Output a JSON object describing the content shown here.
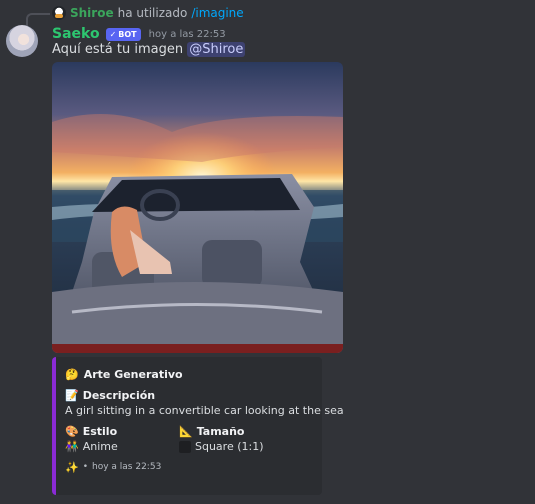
{
  "reply": {
    "username": "Shiroe",
    "action_text": "ha utilizado",
    "command": "/imagine"
  },
  "message": {
    "author": "Saeko",
    "bot_badge": "BOT",
    "timestamp": "hoy a las 22:53",
    "text": "Aquí está tu imagen",
    "mention": "@Shiroe"
  },
  "embed": {
    "accent_color": "#8b2bd6",
    "title_icon": "🤔",
    "title": "Arte Generativo",
    "description_icon": "📝",
    "description_label": "Descripción",
    "description": "A girl sitting in a convertible car looking at the sea",
    "style_icon": "🎨",
    "style_label": "Estilo",
    "style_value_icon": "👫",
    "style_value": "Anime",
    "size_icon": "📐",
    "size_label": "Tamaño",
    "size_value_icon": "square-icon",
    "size_value": "Square (1:1)",
    "footer_icon": "✨",
    "footer_text": "hoy a las 22:53"
  },
  "colors": {
    "background": "#313338",
    "author": "#2dc770",
    "reply_user": "#3ba55c",
    "command": "#00a8fc",
    "bot_badge": "#5865f2"
  }
}
